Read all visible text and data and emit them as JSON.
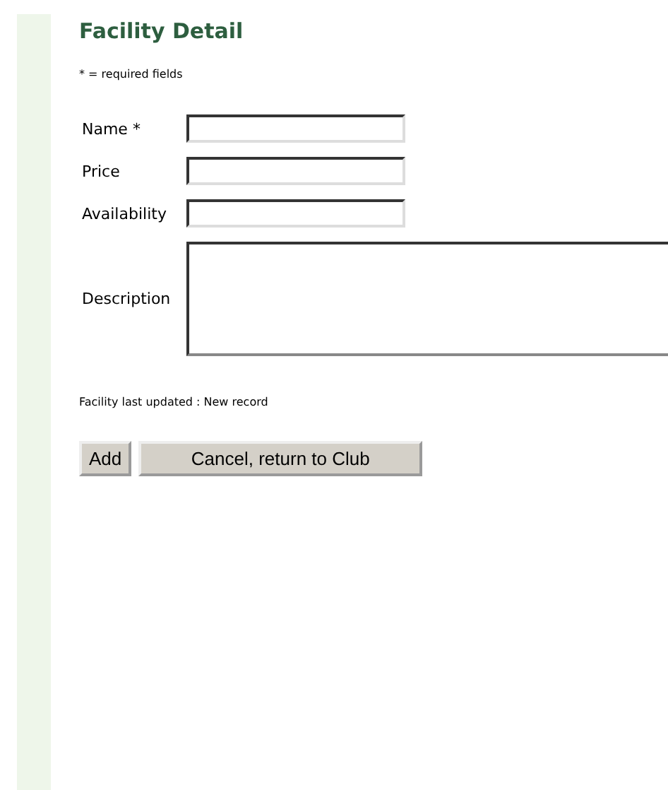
{
  "title": "Facility Detail",
  "required_note": "* = required fields",
  "fields": [
    {
      "label": "Name *",
      "kind": "text"
    },
    {
      "label": "Price",
      "kind": "text"
    },
    {
      "label": "Availability",
      "kind": "text"
    },
    {
      "label": "Description",
      "kind": "textarea"
    }
  ],
  "status": "Facility last updated : New record",
  "buttons": [
    "Add",
    "Cancel, return to Club"
  ]
}
